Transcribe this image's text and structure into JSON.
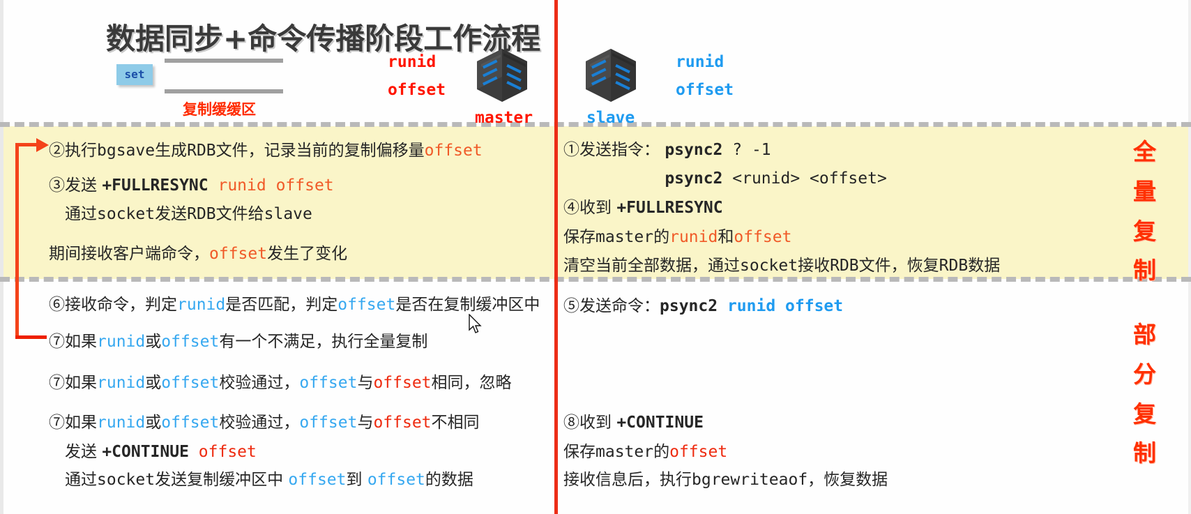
{
  "slide": {
    "title": "数据同步+命令传播阶段工作流程",
    "set_chip": "set",
    "buffer_label": "复制缓缓区",
    "master": {
      "name": "master",
      "runid": "runid",
      "offset": "offset",
      "icon": "server-rack-icon"
    },
    "slave": {
      "name": "slave",
      "runid": "runid",
      "offset": "offset",
      "icon": "server-rack-icon"
    },
    "colors": {
      "band_yellow": "#faf5c8",
      "master_red": "#ff1500",
      "slave_blue": "#1f9bf0",
      "accent_orange": "#f05a28",
      "divider_red": "#ec2d17",
      "title_gray": "#3a3a3a",
      "set_chip_bg": "#8ecbe8"
    }
  },
  "full_replication": {
    "side_label_chars": [
      "全",
      "量",
      "复",
      "制"
    ],
    "master_lines": [
      {
        "id": "step2",
        "segments": [
          {
            "t": "②执行",
            "c": "dark",
            "f": "serif"
          },
          {
            "t": "bgsave",
            "c": "dark",
            "f": "mono"
          },
          {
            "t": "生成",
            "c": "dark",
            "f": "serif"
          },
          {
            "t": "RDB",
            "c": "dark",
            "f": "mono"
          },
          {
            "t": "文件，记录当前的复制偏移量",
            "c": "dark",
            "f": "serif"
          },
          {
            "t": "offset",
            "c": "orange",
            "f": "mono"
          }
        ]
      },
      {
        "id": "step3",
        "segments": [
          {
            "t": "③发送 ",
            "c": "dark",
            "f": "serif"
          },
          {
            "t": "+FULLRESYNC ",
            "c": "dark",
            "f": "mono-bold"
          },
          {
            "t": "runid offset",
            "c": "orange",
            "f": "mono"
          }
        ]
      },
      {
        "id": "step3b",
        "segments": [
          {
            "t": "　通过",
            "c": "dark",
            "f": "serif"
          },
          {
            "t": "socket",
            "c": "dark",
            "f": "mono"
          },
          {
            "t": "发送",
            "c": "dark",
            "f": "serif"
          },
          {
            "t": "RDB",
            "c": "dark",
            "f": "mono"
          },
          {
            "t": "文件给",
            "c": "dark",
            "f": "serif"
          },
          {
            "t": "slave",
            "c": "dark",
            "f": "mono"
          }
        ]
      },
      {
        "id": "note",
        "segments": [
          {
            "t": "期间接收客户端命令，",
            "c": "dark",
            "f": "serif"
          },
          {
            "t": "offset",
            "c": "orange",
            "f": "mono"
          },
          {
            "t": "发生了变化",
            "c": "dark",
            "f": "serif"
          }
        ]
      }
    ],
    "slave_lines": [
      {
        "id": "step1",
        "segments": [
          {
            "t": "①发送指令：  ",
            "c": "dark",
            "f": "serif"
          },
          {
            "t": "psync2",
            "c": "dark",
            "f": "mono-bold"
          },
          {
            "t": "  ? -1",
            "c": "dark",
            "f": "mono"
          }
        ]
      },
      {
        "id": "step1b",
        "segments": [
          {
            "t": "　　　　　　 ",
            "c": "dark",
            "f": "serif"
          },
          {
            "t": "psync2",
            "c": "dark",
            "f": "mono-bold"
          },
          {
            "t": "  <runid> <offset>",
            "c": "dark",
            "f": "mono"
          }
        ]
      },
      {
        "id": "step4",
        "segments": [
          {
            "t": "④收到 ",
            "c": "dark",
            "f": "serif"
          },
          {
            "t": "+FULLRESYNC",
            "c": "dark",
            "f": "mono-bold"
          }
        ]
      },
      {
        "id": "step4b",
        "segments": [
          {
            "t": "保存",
            "c": "dark",
            "f": "serif"
          },
          {
            "t": "master",
            "c": "dark",
            "f": "mono"
          },
          {
            "t": "的",
            "c": "dark",
            "f": "serif"
          },
          {
            "t": "runid",
            "c": "orange",
            "f": "mono"
          },
          {
            "t": "和",
            "c": "dark",
            "f": "serif"
          },
          {
            "t": "offset",
            "c": "orange",
            "f": "mono"
          }
        ]
      },
      {
        "id": "step4c",
        "segments": [
          {
            "t": "清空当前全部数据，通过",
            "c": "dark",
            "f": "serif"
          },
          {
            "t": "socket",
            "c": "dark",
            "f": "mono"
          },
          {
            "t": "接收",
            "c": "dark",
            "f": "serif"
          },
          {
            "t": "RDB",
            "c": "dark",
            "f": "mono"
          },
          {
            "t": "文件，恢复",
            "c": "dark",
            "f": "serif"
          },
          {
            "t": "RDB",
            "c": "dark",
            "f": "mono"
          },
          {
            "t": "数据",
            "c": "dark",
            "f": "serif"
          }
        ]
      }
    ]
  },
  "partial_replication": {
    "side_label_chars": [
      "部",
      "分",
      "复",
      "制"
    ],
    "master_lines": [
      {
        "id": "step6",
        "segments": [
          {
            "t": "⑥接收命令，判定",
            "c": "dark",
            "f": "serif"
          },
          {
            "t": "runid",
            "c": "blue",
            "f": "mono"
          },
          {
            "t": "是否匹配，判定",
            "c": "dark",
            "f": "serif"
          },
          {
            "t": "offset",
            "c": "blue",
            "f": "mono"
          },
          {
            "t": "是否在复制缓冲区中",
            "c": "dark",
            "f": "serif"
          }
        ]
      },
      {
        "id": "step7a",
        "segments": [
          {
            "t": "⑦如果",
            "c": "dark",
            "f": "serif"
          },
          {
            "t": "runid",
            "c": "blue",
            "f": "mono"
          },
          {
            "t": "或",
            "c": "dark",
            "f": "serif"
          },
          {
            "t": "offset",
            "c": "blue",
            "f": "mono"
          },
          {
            "t": "有一个不满足，执行全量复制",
            "c": "dark",
            "f": "serif"
          }
        ]
      },
      {
        "id": "step7b",
        "segments": [
          {
            "t": "⑦如果",
            "c": "dark",
            "f": "serif"
          },
          {
            "t": "runid",
            "c": "blue",
            "f": "mono"
          },
          {
            "t": "或",
            "c": "dark",
            "f": "serif"
          },
          {
            "t": "offset",
            "c": "blue",
            "f": "mono"
          },
          {
            "t": "校验通过，",
            "c": "dark",
            "f": "serif"
          },
          {
            "t": "offset",
            "c": "blue",
            "f": "mono"
          },
          {
            "t": "与",
            "c": "dark",
            "f": "serif"
          },
          {
            "t": "offset",
            "c": "red",
            "f": "mono"
          },
          {
            "t": "相同，忽略",
            "c": "dark",
            "f": "serif"
          }
        ]
      },
      {
        "id": "step7c",
        "segments": [
          {
            "t": "⑦如果",
            "c": "dark",
            "f": "serif"
          },
          {
            "t": "runid",
            "c": "blue",
            "f": "mono"
          },
          {
            "t": "或",
            "c": "dark",
            "f": "serif"
          },
          {
            "t": "offset",
            "c": "blue",
            "f": "mono"
          },
          {
            "t": "校验通过，",
            "c": "dark",
            "f": "serif"
          },
          {
            "t": "offset",
            "c": "blue",
            "f": "mono"
          },
          {
            "t": "与",
            "c": "dark",
            "f": "serif"
          },
          {
            "t": "offset",
            "c": "red",
            "f": "mono"
          },
          {
            "t": "不相同",
            "c": "dark",
            "f": "serif"
          }
        ]
      },
      {
        "id": "step7d",
        "segments": [
          {
            "t": "　发送 ",
            "c": "dark",
            "f": "serif"
          },
          {
            "t": "+CONTINUE ",
            "c": "dark",
            "f": "mono-bold"
          },
          {
            "t": "offset",
            "c": "red",
            "f": "mono"
          }
        ]
      },
      {
        "id": "step7e",
        "segments": [
          {
            "t": "　通过",
            "c": "dark",
            "f": "serif"
          },
          {
            "t": "socket",
            "c": "dark",
            "f": "mono"
          },
          {
            "t": "发送复制缓冲区中 ",
            "c": "dark",
            "f": "serif"
          },
          {
            "t": "offset",
            "c": "blue",
            "f": "mono"
          },
          {
            "t": "到 ",
            "c": "dark",
            "f": "serif"
          },
          {
            "t": "offset",
            "c": "blue",
            "f": "mono"
          },
          {
            "t": "的数据",
            "c": "dark",
            "f": "serif"
          }
        ]
      }
    ],
    "slave_lines": [
      {
        "id": "step5",
        "segments": [
          {
            "t": "⑤发送命令：",
            "c": "dark",
            "f": "serif"
          },
          {
            "t": "psync2",
            "c": "dark",
            "f": "mono-bold"
          },
          {
            "t": "  runid offset",
            "c": "blue2",
            "f": "mono-bold"
          }
        ]
      },
      {
        "id": "step8",
        "segments": [
          {
            "t": "⑧收到 ",
            "c": "dark",
            "f": "serif"
          },
          {
            "t": "+CONTINUE",
            "c": "dark",
            "f": "mono-bold"
          }
        ]
      },
      {
        "id": "step8b",
        "segments": [
          {
            "t": "保存",
            "c": "dark",
            "f": "serif"
          },
          {
            "t": "master",
            "c": "dark",
            "f": "mono"
          },
          {
            "t": "的",
            "c": "dark",
            "f": "serif"
          },
          {
            "t": "offset",
            "c": "red",
            "f": "mono"
          }
        ]
      },
      {
        "id": "step8c",
        "segments": [
          {
            "t": "接收信息后，执行",
            "c": "dark",
            "f": "serif"
          },
          {
            "t": "bgrewriteaof",
            "c": "dark",
            "f": "mono"
          },
          {
            "t": "，恢复数据",
            "c": "dark",
            "f": "serif"
          }
        ]
      }
    ]
  }
}
